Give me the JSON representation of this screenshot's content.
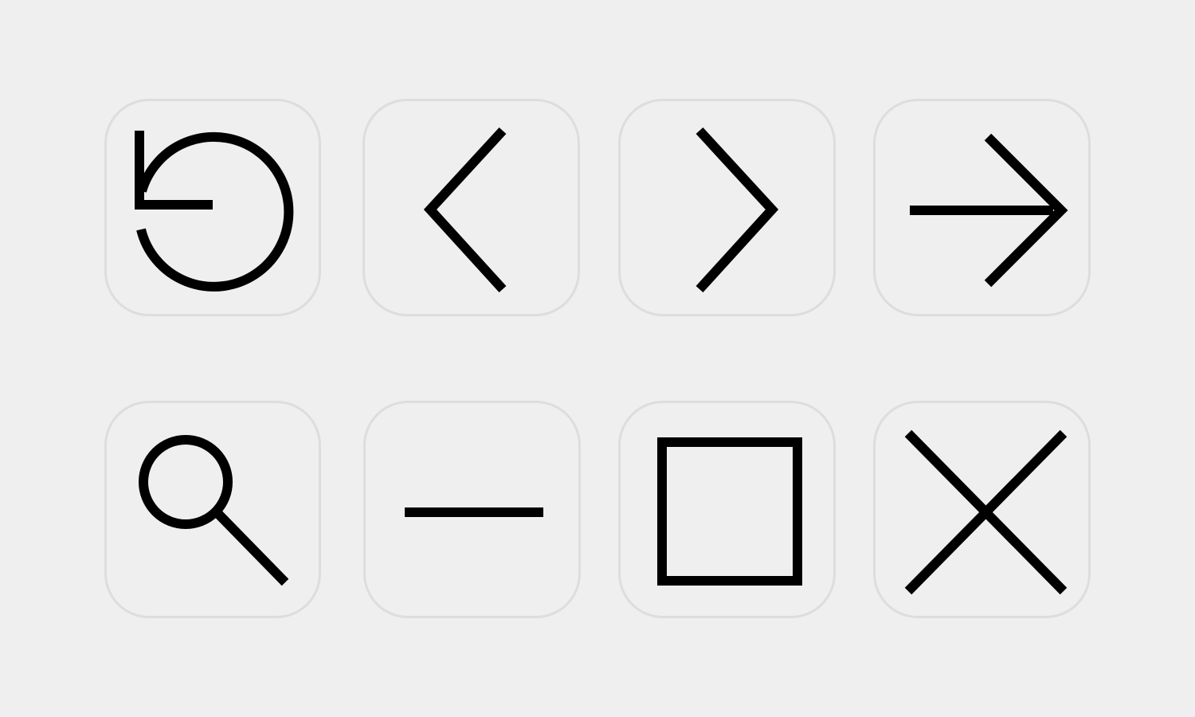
{
  "icons": [
    {
      "name": "refresh-icon",
      "color": "#000000"
    },
    {
      "name": "chevron-left-icon",
      "color": "#000000"
    },
    {
      "name": "chevron-right-icon",
      "color": "#000000"
    },
    {
      "name": "arrow-right-icon",
      "color": "#000000"
    },
    {
      "name": "search-icon",
      "color": "#000000"
    },
    {
      "name": "minimize-icon",
      "color": "#000000"
    },
    {
      "name": "maximize-icon",
      "color": "#000000"
    },
    {
      "name": "close-icon",
      "color": "#000000"
    }
  ],
  "colors": {
    "background": "#efefef",
    "button_border": "#dddddd",
    "icon_stroke": "#000000"
  }
}
